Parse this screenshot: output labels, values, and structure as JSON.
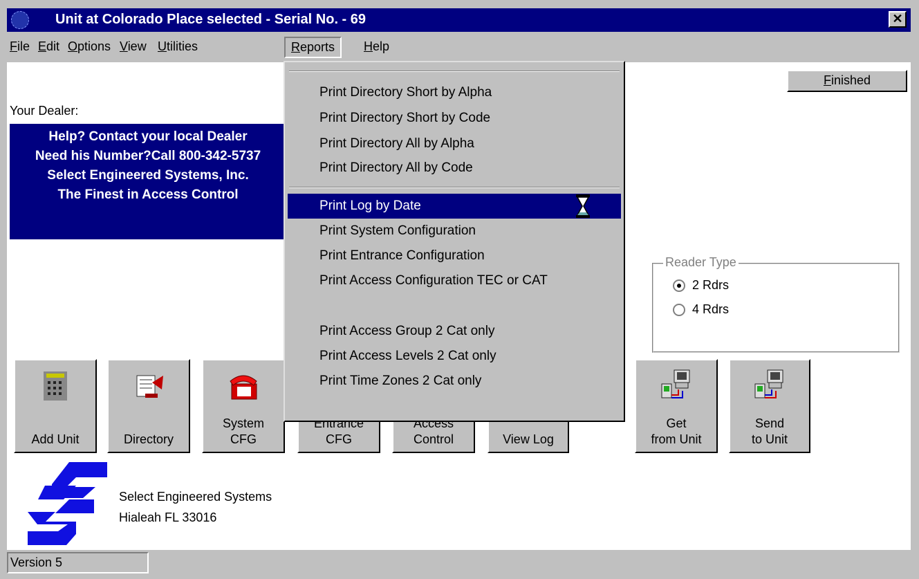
{
  "window": {
    "title": "Unit at Colorado Place selected  - Serial No. - 69",
    "close_label": "✕"
  },
  "menubar": {
    "items": [
      {
        "label": "File",
        "mnemonic": "F"
      },
      {
        "label": "Edit",
        "mnemonic": "E"
      },
      {
        "label": "Options",
        "mnemonic": "O"
      },
      {
        "label": "View",
        "mnemonic": "V"
      },
      {
        "label": "Utilities",
        "mnemonic": "U"
      },
      {
        "label": "Reports",
        "mnemonic": "R",
        "active": true
      },
      {
        "label": "Help",
        "mnemonic": "H"
      }
    ]
  },
  "finished_button": "Finished",
  "dealer": {
    "label": "Your Dealer:",
    "lines": [
      "Help? Contact  your local Dealer",
      "Need his Number?Call 800-342-5737",
      "Select Engineered Systems, Inc.",
      "The Finest in Access Control"
    ]
  },
  "reader_type": {
    "legend": "Reader Type",
    "options": [
      {
        "label": "2 Rdrs",
        "selected": true
      },
      {
        "label": "4 Rdrs",
        "selected": false
      }
    ]
  },
  "toolbar": {
    "buttons": [
      {
        "label": "Add Unit",
        "icon": "keypad-icon"
      },
      {
        "label": "Directory",
        "icon": "directory-icon"
      },
      {
        "label": "System\nCFG",
        "icon": "phone-icon"
      },
      {
        "label": "Entrance\nCFG",
        "icon": "entrance-icon"
      },
      {
        "label": "Access\nControl",
        "icon": "access-icon"
      },
      {
        "label": "View Log",
        "icon": "log-icon"
      },
      {
        "label": "Get\nfrom Unit",
        "icon": "computer-download-icon"
      },
      {
        "label": "Send\nto Unit",
        "icon": "computer-upload-icon"
      }
    ]
  },
  "company": {
    "name": "Select Engineered Systems",
    "address": "Hialeah FL 33016"
  },
  "status": {
    "version": "Version 5"
  },
  "reports_menu": {
    "items": [
      "Print Directory Short by Alpha",
      "Print Directory Short by Code",
      "Print Directory All by Alpha",
      "Print Directory All by Code",
      "Print Log by Date",
      "Print System Configuration",
      "Print Entrance Configuration",
      "Print Access Configuration TEC or CAT",
      "Print Access Group 2 Cat only",
      "Print Access Levels 2 Cat only",
      "Print Time Zones 2 Cat only"
    ],
    "highlighted": "Print Log by Date"
  },
  "colors": {
    "titlebar": "#000080",
    "face": "#c0c0c0",
    "dealer_box": "#000080",
    "logo": "#1010e0"
  }
}
